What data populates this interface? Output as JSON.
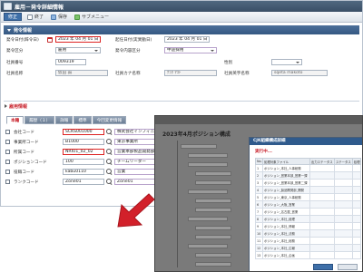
{
  "window": {
    "title": "雇用－発令詳細情報"
  },
  "toolbar": {
    "buttons": [
      {
        "label": "修正",
        "active": true
      },
      {
        "label": "終了"
      },
      {
        "label": "保存"
      },
      {
        "label": "サブメニュー"
      }
    ]
  },
  "section1": {
    "title": "発令情報"
  },
  "form": {
    "hatsurei_date_label": "発令日付(辞令日)",
    "hatsurei_date_value": "2023 年 04 月 01 日",
    "kikan_label": "起任日付(実異動日)",
    "kikan_value": "2023 年 04 月 01 日",
    "hatsurei_kubun_label": "発令区分",
    "hatsurei_kubun_value": "雇用",
    "hatsurei_naiyo_label": "発令内容区分",
    "hatsurei_naiyo_value": "中途採用",
    "shain_no_label": "社員番号",
    "shain_no_value": "009319",
    "seibetsu_label": "性別",
    "seibetsu_value": "",
    "shain_name_label": "社員名称",
    "shain_name_value": "仮田 誠",
    "kana_label": "社員カナ名称",
    "kana_value": "ｸﾗﾀ ﾏｺﾄ",
    "eiji_label": "社員英字名称",
    "eiji_value": "sqeta makoto"
  },
  "section2": {
    "title": "雇用情報"
  },
  "tabs": [
    {
      "label": "本籍"
    },
    {
      "label": "履歴（１）"
    },
    {
      "label": "詳報"
    },
    {
      "label": "標準"
    },
    {
      "label": "今回変更情報"
    }
  ],
  "rows": [
    {
      "label": "会社コード",
      "code": "SCKS001000",
      "name": "株式会社インフィニイエ(グ",
      "required": true
    },
    {
      "label": "事業所コード",
      "code": "B1000",
      "name": "東京事業所",
      "required": false
    },
    {
      "label": "所属コード",
      "code": "NRIU1_02_02",
      "name": "営業本部製品開発部",
      "required": true
    },
    {
      "label": "ポジションコード",
      "code": "100",
      "name": "チームリーダー",
      "required": false
    },
    {
      "label": "役職コード",
      "code": "kabu0110",
      "name": "営業",
      "required": false
    },
    {
      "label": "ランクコード",
      "code": "Zone01",
      "name": "Zone01",
      "required": false
    }
  ],
  "overlay": {
    "org_title": "2023年4月ポジション構成",
    "dialog_title": "CJK組織構成詳細",
    "dialog_sub": "実行中...",
    "table_headers": [
      "No.",
      "処理対象ファイル",
      "出力ステータス",
      "ステータス",
      "処理"
    ],
    "table_rows": [
      [
        "1",
        "ポジション_本社_人事総務",
        "",
        "",
        ""
      ],
      [
        "2",
        "ポジション_営業本部_営業一課",
        "",
        "",
        ""
      ],
      [
        "3",
        "ポジション_営業本部_営業二課",
        "",
        "",
        ""
      ],
      [
        "4",
        "ポジション_製品開発部_開発",
        "",
        "",
        ""
      ],
      [
        "5",
        "ポジション_東京_人事総務",
        "",
        "",
        ""
      ],
      [
        "6",
        "ポジション_大阪_営業",
        "",
        "",
        ""
      ],
      [
        "7",
        "ポジション_名古屋_営業",
        "",
        "",
        ""
      ],
      [
        "8",
        "ポジション_本社_経理",
        "",
        "",
        ""
      ],
      [
        "9",
        "ポジション_本社_情報",
        "",
        "",
        ""
      ],
      [
        "10",
        "ポジション_本社_法務",
        "",
        "",
        ""
      ],
      [
        "11",
        "ポジション_本社_総務",
        "",
        "",
        ""
      ],
      [
        "12",
        "ポジション_本社_広報",
        "",
        "",
        ""
      ],
      [
        "13",
        "ポジション_本社_企画",
        "",
        "",
        ""
      ]
    ]
  },
  "colors": {
    "accent": "#3e6fa8",
    "required": "#c8212b",
    "arrow": "#d2202a"
  }
}
